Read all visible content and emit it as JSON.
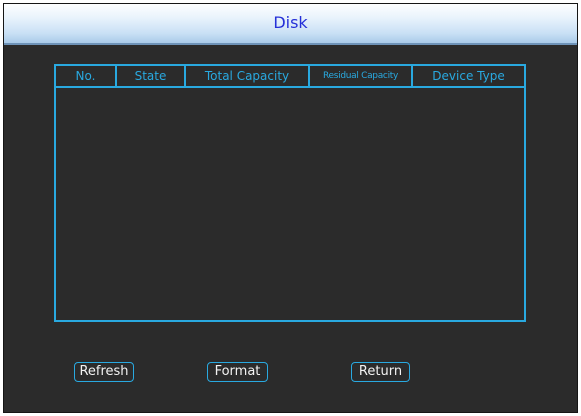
{
  "window": {
    "title": "Disk"
  },
  "disk_table": {
    "columns": [
      "No.",
      "State",
      "Total Capacity",
      "Residual Capacity",
      "Device Type"
    ],
    "rows": []
  },
  "buttons": {
    "refresh": "Refresh",
    "format": "Format",
    "return": "Return"
  },
  "colors": {
    "background": "#2b2b2b",
    "accent": "#29a9e0",
    "title_text": "#2530d8",
    "button_text": "#f2f2f2"
  }
}
